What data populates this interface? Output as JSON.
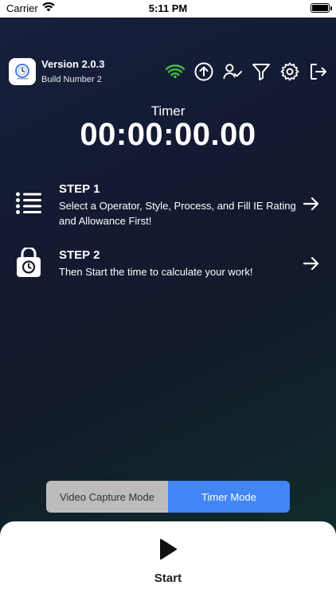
{
  "status_bar": {
    "carrier": "Carrier",
    "time": "5:11 PM"
  },
  "header": {
    "version": "Version 2.0.3",
    "build": "Build Number 2",
    "icons": [
      "wifi-icon",
      "upload-icon",
      "user-check-icon",
      "filter-icon",
      "gear-icon",
      "logout-icon"
    ],
    "wifi_color": "#3fbf3f"
  },
  "timer": {
    "label": "Timer",
    "value": "00:00:00.00"
  },
  "steps": [
    {
      "title": "STEP 1",
      "description": "Select a Operator, Style, Process, and Fill IE Rating and Allowance First!",
      "icon": "list-icon"
    },
    {
      "title": "STEP 2",
      "description": "Then Start the time to calculate your work!",
      "icon": "lock-timer-icon"
    }
  ],
  "modes": {
    "video": "Video Capture Mode",
    "timer": "Timer Mode",
    "active": "timer"
  },
  "start": {
    "label": "Start"
  },
  "colors": {
    "accent": "#4285f4",
    "inactive_mode": "#bcbcbc"
  }
}
